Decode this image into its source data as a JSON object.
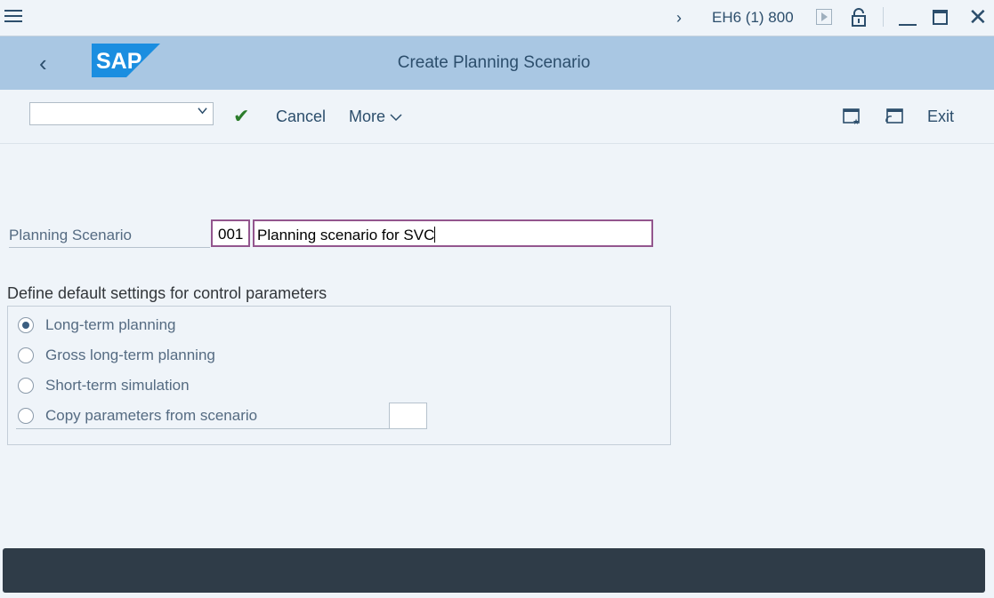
{
  "system": {
    "session": "EH6 (1) 800"
  },
  "header": {
    "title": "Create Planning Scenario"
  },
  "toolbar": {
    "command_value": "",
    "cancel_label": "Cancel",
    "more_label": "More",
    "exit_label": "Exit"
  },
  "form": {
    "planning_scenario_label": "Planning Scenario",
    "scenario_code": "001",
    "scenario_name": "Planning scenario for SVC"
  },
  "control_params": {
    "title": "Define default settings for control parameters",
    "options": [
      {
        "label": "Long-term planning",
        "selected": true
      },
      {
        "label": "Gross long-term planning",
        "selected": false
      },
      {
        "label": "Short-term simulation",
        "selected": false
      },
      {
        "label": "Copy parameters from scenario",
        "selected": false
      }
    ],
    "copy_from_value": ""
  },
  "colors": {
    "header_bg": "#a9c7e3",
    "accent_text": "#2c4e6c",
    "focus_border": "#93568e",
    "check_green": "#2b7c2b",
    "statusbar_bg": "#2f3c48"
  }
}
